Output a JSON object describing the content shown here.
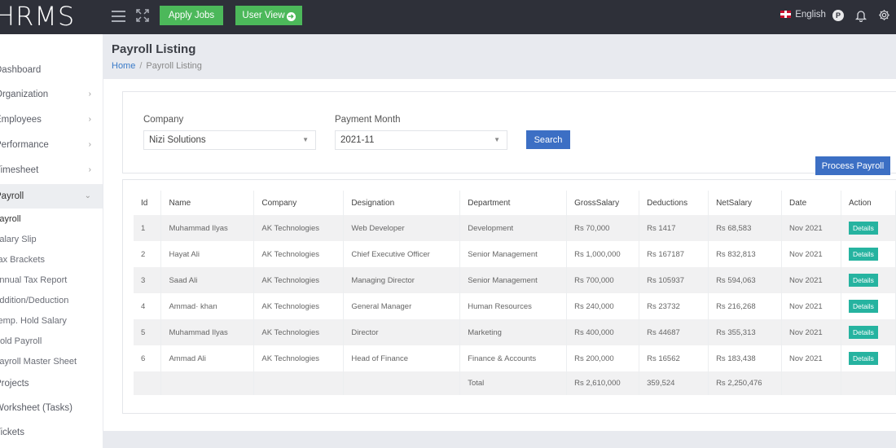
{
  "app": {
    "logo": "HRMS"
  },
  "topbar": {
    "apply_jobs": "Apply Jobs",
    "user_view": "User View",
    "language": "English",
    "avatar_initial": "P"
  },
  "sidebar": {
    "items": [
      {
        "label": "Dashboard",
        "chevron": ""
      },
      {
        "label": "Organization",
        "chevron": ">"
      },
      {
        "label": "Employees",
        "chevron": ">"
      },
      {
        "label": "Performance",
        "chevron": ">"
      },
      {
        "label": "Timesheet",
        "chevron": ">"
      },
      {
        "label": "Payroll",
        "chevron": "v"
      }
    ],
    "sub_items": [
      "Payroll",
      "Salary Slip",
      "Tax Brackets",
      "Annual Tax Report",
      "Addition/Deduction",
      "Temp. Hold Salary",
      "Hold Payroll",
      "Payroll Master Sheet"
    ],
    "after_items": [
      "Projects",
      "Worksheet (Tasks)",
      "Tickets"
    ]
  },
  "page": {
    "title": "Payroll Listing",
    "breadcrumb": {
      "home": "Home",
      "separator": "/",
      "current": "Payroll Listing"
    }
  },
  "filters": {
    "company_label": "Company",
    "company_value": "Nizi Solutions",
    "month_label": "Payment Month",
    "month_value": "2021-11",
    "search_button": "Search",
    "process_button": "Process Payroll"
  },
  "table": {
    "headers": [
      "Id",
      "Name",
      "Company",
      "Designation",
      "Department",
      "GrossSalary",
      "Deductions",
      "NetSalary",
      "Date",
      "Action"
    ],
    "rows": [
      {
        "id": "1",
        "name": "Muhammad Ilyas",
        "company": "AK Technologies",
        "designation": "Web Developer",
        "department": "Development",
        "gross": "Rs 70,000",
        "deductions": "Rs 1417",
        "net": "Rs 68,583",
        "date": "Nov 2021",
        "action": "Details"
      },
      {
        "id": "2",
        "name": "Hayat Ali",
        "company": "AK Technologies",
        "designation": "Chief Executive Officer",
        "department": "Senior Management",
        "gross": "Rs 1,000,000",
        "deductions": "Rs 167187",
        "net": "Rs 832,813",
        "date": "Nov 2021",
        "action": "Details"
      },
      {
        "id": "3",
        "name": "Saad Ali",
        "company": "AK Technologies",
        "designation": "Managing Director",
        "department": "Senior Management",
        "gross": "Rs 700,000",
        "deductions": "Rs 105937",
        "net": "Rs 594,063",
        "date": "Nov 2021",
        "action": "Details"
      },
      {
        "id": "4",
        "name": " Ammad· khan",
        "company": "AK Technologies",
        "designation": "General Manager",
        "department": "Human Resources",
        "gross": "Rs 240,000",
        "deductions": "Rs 23732",
        "net": "Rs 216,268",
        "date": "Nov 2021",
        "action": "Details"
      },
      {
        "id": "5",
        "name": "Muhammad Ilyas",
        "company": "AK Technologies",
        "designation": "Director",
        "department": "Marketing",
        "gross": "Rs 400,000",
        "deductions": "Rs 44687",
        "net": "Rs 355,313",
        "date": "Nov 2021",
        "action": "Details"
      },
      {
        "id": "6",
        "name": "Ammad Ali",
        "company": "AK Technologies",
        "designation": "Head of Finance",
        "department": "Finance & Accounts",
        "gross": "Rs 200,000",
        "deductions": "Rs 16562",
        "net": "Rs 183,438",
        "date": "Nov 2021",
        "action": "Details"
      }
    ],
    "total": {
      "label": "Total",
      "gross": "Rs 2,610,000",
      "deductions": "359,524",
      "net": "Rs 2,250,476"
    }
  },
  "colors": {
    "topbar": "#2e3039",
    "green_button": "#4cb85a",
    "primary": "#3c6fc4",
    "details": "#26b3a0",
    "link": "#3a7bc8"
  }
}
